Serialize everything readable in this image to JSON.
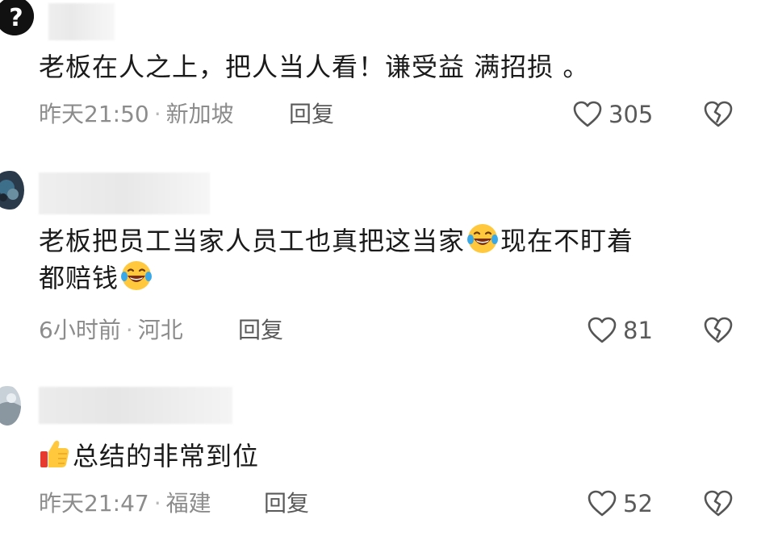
{
  "comments": [
    {
      "text": "老板在人之上，把人当人看！谦受益 满招损 。",
      "time": "昨天21:50",
      "location": "新加坡",
      "reply_label": "回复",
      "likes": "305"
    },
    {
      "text_1": "老板把员工当家人员工也真把这当家",
      "text_2": "现在不盯着",
      "text_3": "都赔钱",
      "time": "6小时前",
      "location": "河北",
      "reply_label": "回复",
      "likes": "81"
    },
    {
      "text": "总结的非常到位",
      "time": "昨天21:47",
      "location": "福建",
      "reply_label": "回复",
      "likes": "52"
    }
  ],
  "separator": "·",
  "icons": {
    "like": "heart-outline-icon",
    "dislike": "broken-heart-icon",
    "laugh": "tears-of-joy-emoji",
    "thumb": "thumbs-up-emoji"
  },
  "colors": {
    "text": "#1a1a1a",
    "meta": "#8c8c8c",
    "action": "#5a5a5a"
  }
}
